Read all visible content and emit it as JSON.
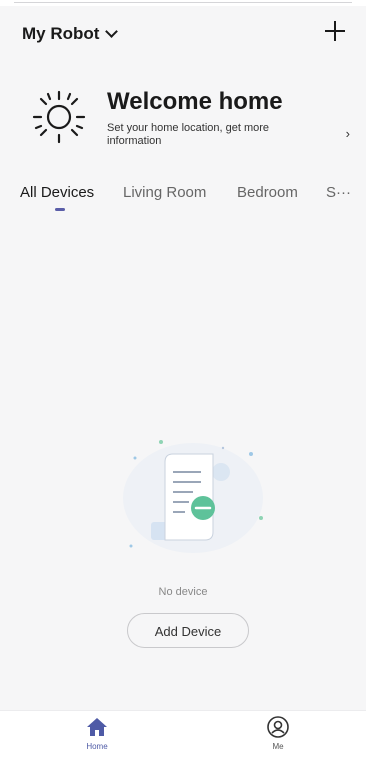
{
  "header": {
    "home_name": "My Robot"
  },
  "welcome": {
    "title": "Welcome home",
    "subtitle": "Set your home location, get more information",
    "arrow": "›"
  },
  "tabs": {
    "items": [
      {
        "label": "All Devices",
        "active": true
      },
      {
        "label": "Living Room",
        "active": false
      },
      {
        "label": "Bedroom",
        "active": false
      }
    ],
    "more": "S···"
  },
  "empty_state": {
    "message": "No device",
    "button_label": "Add Device"
  },
  "bottom_nav": {
    "items": [
      {
        "label": "Home",
        "icon": "home-icon",
        "active": true
      },
      {
        "label": "Me",
        "icon": "user-icon",
        "active": false
      }
    ]
  },
  "colors": {
    "accent": "#4e5aa6",
    "background": "#f6f6f7"
  }
}
